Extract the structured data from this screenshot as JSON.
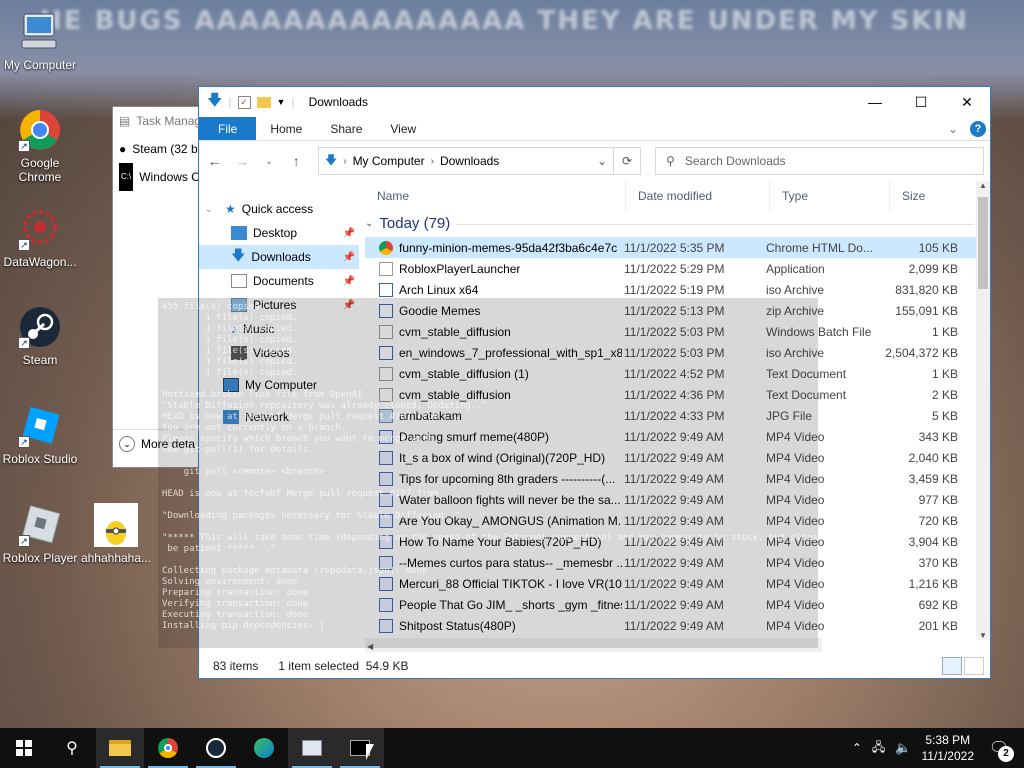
{
  "wallpaper": {
    "text": "HE BUGS AAAAAAAAAAAAAAA THEY ARE UNDER MY SKIN"
  },
  "desktop_icons": [
    {
      "label": "My Computer",
      "icon": "computer-icon"
    },
    {
      "label": "Google Chrome",
      "icon": "chrome-icon"
    },
    {
      "label": "DataWagon...",
      "icon": "datawagon-icon"
    },
    {
      "label": "Steam",
      "icon": "steam-icon"
    },
    {
      "label": "Roblox Studio",
      "icon": "roblox-studio-icon"
    },
    {
      "label": "Roblox Player",
      "icon": "roblox-player-icon"
    },
    {
      "label": "ahhahhaha...",
      "icon": "image-file-icon"
    }
  ],
  "taskmgr": {
    "title": "Task Manag",
    "rows": [
      "Steam (32 b",
      "Windows C"
    ],
    "more": "More deta"
  },
  "terminal": {
    "lines": [
      "455 file(s) copied.",
      "        1 file(s) copied.",
      "        1 file(s) copied.",
      "        1 file(s) copied.",
      "        1 file(s) copied.",
      "        1 file(s) copied.",
      "        1 file(s) copied.",
      "",
      "Hotfixed broken link file from OpenAI",
      "\"Stable Diffusion repository was already cloned. Updating..\"",
      "HEAD is now at f6cfebf Merge pull request #187 from ...",
      "You are not currently on a branch.",
      "Please specify which branch you want to merge with.",
      "See git-pull(1) for details.",
      "",
      "    git pull <remote> <branch>",
      "",
      "HEAD is now at f6cfebf Merge pull request #187 from ...",
      "",
      "\"Downloading packages necessary for Stable Diffusion..\"",
      "",
      "\"***** This will take some time (depending on the speed of the Internet connection) and may appear to be stuck, but please",
      " be patient ***** ..\"",
      "",
      "Collecting package metadata (repodata.json): done",
      "Solving environment: done",
      "Preparing transaction: done",
      "Verifying transaction: done",
      "Executing transaction: done",
      "Installing pip dependencies: |"
    ]
  },
  "explorer": {
    "title": "Downloads",
    "ribbon": {
      "tabs": [
        "File",
        "Home",
        "Share",
        "View"
      ]
    },
    "address": {
      "parts": [
        "My Computer",
        "Downloads"
      ]
    },
    "search_placeholder": "Search Downloads",
    "nav": [
      {
        "label": "Quick access",
        "icon": "star-icon",
        "pinned": false,
        "level": 0
      },
      {
        "label": "Desktop",
        "icon": "desktop-folder-icon",
        "pinned": true,
        "level": 1
      },
      {
        "label": "Downloads",
        "icon": "download-folder-icon",
        "pinned": true,
        "level": 1,
        "selected": true
      },
      {
        "label": "Documents",
        "icon": "documents-folder-icon",
        "pinned": true,
        "level": 1
      },
      {
        "label": "Pictures",
        "icon": "pictures-folder-icon",
        "pinned": true,
        "level": 1
      },
      {
        "label": "Music",
        "icon": "music-folder-icon",
        "pinned": false,
        "level": 1
      },
      {
        "label": "Videos",
        "icon": "videos-folder-icon",
        "pinned": false,
        "level": 1
      },
      {
        "label": "My Computer",
        "icon": "computer-icon",
        "pinned": false,
        "level": 0
      },
      {
        "label": "Network",
        "icon": "network-icon",
        "pinned": false,
        "level": 0
      }
    ],
    "columns": [
      "Name",
      "Date modified",
      "Type",
      "Size"
    ],
    "group_label": "Today (79)",
    "files": [
      {
        "name": "funny-minion-memes-95da42f3ba6c4e7c",
        "date": "11/1/2022 5:35 PM",
        "type": "Chrome HTML Do...",
        "size": "105 KB",
        "icon": "chrome"
      },
      {
        "name": "RobloxPlayerLauncher",
        "date": "11/1/2022 5:29 PM",
        "type": "Application",
        "size": "2,099 KB",
        "icon": "app"
      },
      {
        "name": "Arch Linux x64",
        "date": "11/1/2022 5:19 PM",
        "type": "iso Archive",
        "size": "831,820 KB",
        "icon": "iso"
      },
      {
        "name": "Goodie Memes",
        "date": "11/1/2022 5:13 PM",
        "type": "zip Archive",
        "size": "155,091 KB",
        "icon": "zip"
      },
      {
        "name": "cvm_stable_diffusion",
        "date": "11/1/2022 5:03 PM",
        "type": "Windows Batch File",
        "size": "1 KB",
        "icon": "bat"
      },
      {
        "name": "en_windows_7_professional_with_sp1_x8...",
        "date": "11/1/2022 5:03 PM",
        "type": "iso Archive",
        "size": "2,504,372 KB",
        "icon": "iso"
      },
      {
        "name": "cvm_stable_diffusion (1)",
        "date": "11/1/2022 4:52 PM",
        "type": "Text Document",
        "size": "1 KB",
        "icon": "txt"
      },
      {
        "name": "cvm_stable_diffusion",
        "date": "11/1/2022 4:36 PM",
        "type": "Text Document",
        "size": "2 KB",
        "icon": "txt"
      },
      {
        "name": "ambatakam",
        "date": "11/1/2022 4:33 PM",
        "type": "JPG File",
        "size": "5 KB",
        "icon": "jpg"
      },
      {
        "name": "Dancing smurf meme(480P)",
        "date": "11/1/2022 9:49 AM",
        "type": "MP4 Video",
        "size": "343 KB",
        "icon": "mp4"
      },
      {
        "name": "It_s a box of wind (Original)(720P_HD)",
        "date": "11/1/2022 9:49 AM",
        "type": "MP4 Video",
        "size": "2,040 KB",
        "icon": "mp4"
      },
      {
        "name": "Tips for upcoming 8th graders ----------(...",
        "date": "11/1/2022 9:49 AM",
        "type": "MP4 Video",
        "size": "3,459 KB",
        "icon": "mp4"
      },
      {
        "name": "Water balloon fights will never be the sa...",
        "date": "11/1/2022 9:49 AM",
        "type": "MP4 Video",
        "size": "977 KB",
        "icon": "mp4"
      },
      {
        "name": "Are You Okay_ AMONGUS (Animation M...",
        "date": "11/1/2022 9:49 AM",
        "type": "MP4 Video",
        "size": "720 KB",
        "icon": "mp4"
      },
      {
        "name": "How To Name Your Babies(720P_HD)",
        "date": "11/1/2022 9:49 AM",
        "type": "MP4 Video",
        "size": "3,904 KB",
        "icon": "mp4"
      },
      {
        "name": "--Memes curtos para status-- _memesbr ...",
        "date": "11/1/2022 9:49 AM",
        "type": "MP4 Video",
        "size": "370 KB",
        "icon": "mp4"
      },
      {
        "name": "Mercuri_88 Official TIKTOK - I love VR(108...",
        "date": "11/1/2022 9:49 AM",
        "type": "MP4 Video",
        "size": "1,216 KB",
        "icon": "mp4"
      },
      {
        "name": "People That Go JIM_ _shorts _gym _fitnes...",
        "date": "11/1/2022 9:49 AM",
        "type": "MP4 Video",
        "size": "692 KB",
        "icon": "mp4"
      },
      {
        "name": "Shitpost Status(480P)",
        "date": "11/1/2022 9:49 AM",
        "type": "MP4 Video",
        "size": "201 KB",
        "icon": "mp4"
      }
    ],
    "status": {
      "items": "83 items",
      "selected": "1 item selected",
      "sel_size": "54.9 KB"
    }
  },
  "taskbar": {
    "apps": [
      "start-icon",
      "search-icon",
      "file-explorer-icon",
      "chrome-icon",
      "steam-icon",
      "edge-icon",
      "task-manager-icon",
      "cmd-icon"
    ],
    "time": "5:38 PM",
    "date": "11/1/2022",
    "notifications": "2"
  },
  "colors": {
    "accent": "#1979ca",
    "selection": "#cce8ff",
    "group": "#1e3287",
    "taskbar": "#101010"
  }
}
